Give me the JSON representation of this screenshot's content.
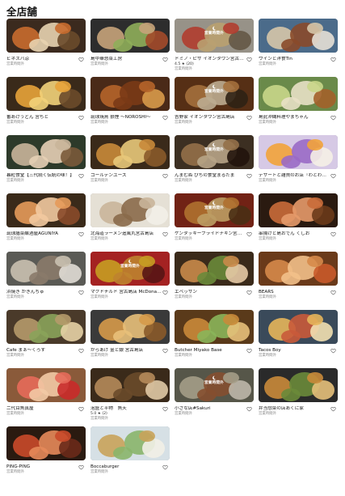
{
  "page": {
    "title": "全店舗"
  },
  "closed_overlay_text": "営業時間外",
  "icons": {
    "favorite": "heart-outline-icon",
    "closed": "moon-icon",
    "rating": "star-icon"
  },
  "stores": [
    {
      "name": "ビネスバ涼",
      "status": "営業時間外",
      "palette": [
        "#3b2a1e",
        "#c96b2e",
        "#e8d3b0",
        "#6a4a2a"
      ]
    },
    {
      "name": "島中華惣菜工房",
      "status": "営業時間外",
      "palette": [
        "#2d2d2d",
        "#c7a37a",
        "#8fae5a",
        "#a34a2a"
      ]
    },
    {
      "name": "ドミノ・ピザ イオンタウン宮古島店 Do…",
      "status": "営業時間外",
      "rating": "4.5 ★ (20)",
      "closed_overlay": true,
      "palette": [
        "#b9b3a6",
        "#d84a3a",
        "#e2c48a",
        "#7a6a55"
      ]
    },
    {
      "name": "ワインと洋食Tin",
      "status": "営業時間外",
      "palette": [
        "#4b6b8a",
        "#d6c7a8",
        "#8a4a2a",
        "#e5e0d5"
      ]
    },
    {
      "name": "番あげうどん 宮ちと",
      "status": "営業時間外",
      "palette": [
        "#3a2a1a",
        "#e8a33a",
        "#f2d27a",
        "#6b4a2a"
      ]
    },
    {
      "name": "琉球焼鳥 狼煙 〜NOROSHI〜",
      "status": "営業時間外",
      "palette": [
        "#4a2a18",
        "#b5642a",
        "#7a3a16",
        "#d89a4a"
      ]
    },
    {
      "name": "吉野家 イオンタウン宮古島店",
      "status": "営業時間外",
      "closed_overlay": true,
      "palette": [
        "#6a3a1a",
        "#c98a4a",
        "#e5d2b0",
        "#3a2a1a"
      ]
    },
    {
      "name": "島此沖縄料理やまちゃん",
      "status": "営業時間外",
      "palette": [
        "#6a8a4a",
        "#c9d68a",
        "#e8e0c5",
        "#a3602a"
      ]
    },
    {
      "name": "暮粒食堂【三代続く伝統の味！】",
      "status": "営業時間外",
      "palette": [
        "#2d3a2a",
        "#c9b59a",
        "#e5cfb5",
        "#7a5a3a"
      ]
    },
    {
      "name": "ゴールデンユース",
      "status": "営業時間外",
      "palette": [
        "#3a2a1a",
        "#c98a3a",
        "#e8c87a",
        "#8a5a2a"
      ]
    },
    {
      "name": "んまむぬ ぴちの食堂まるたま",
      "status": "営業時間外",
      "closed_overlay": true,
      "palette": [
        "#4a3a2a",
        "#b58a5a",
        "#e0c9a5",
        "#2a1a10"
      ]
    },
    {
      "name": "デザートと雑貨のお店『わとわと』",
      "status": "営業時間外",
      "palette": [
        "#d6c9e5",
        "#f2a33a",
        "#9a6ac5",
        "#f5efe5"
      ]
    },
    {
      "name": "琉球膳菜醸酒屋AGUNIYA",
      "status": "営業時間外",
      "palette": [
        "#3a2a1a",
        "#e59a5a",
        "#f2c9a0",
        "#8a4a2a"
      ]
    },
    {
      "name": "北海道ラーメン追風丸宮古島店",
      "status": "営業時間外",
      "palette": [
        "#e5e0d5",
        "#c9b59a",
        "#8a6a4a",
        "#f2efe8"
      ]
    },
    {
      "name": "ケンタッキーフライドチキン宮古島店 KFC",
      "status": "営業時間外",
      "closed_overlay": true,
      "palette": [
        "#8a2a1a",
        "#d68a3a",
        "#e5c07a",
        "#5a3a1a"
      ]
    },
    {
      "name": "串揚げと島おでん くしお",
      "status": "営業時間外",
      "palette": [
        "#2a1a10",
        "#c96b3a",
        "#e59a6a",
        "#6a3a1a"
      ]
    },
    {
      "name": "浜焼き かきんちゅ",
      "status": "営業時間外",
      "palette": [
        "#5a5a55",
        "#c9c0b0",
        "#8a7a6a",
        "#e0dcd5"
      ]
    },
    {
      "name": "マクドナルド 宮古島店 McDonald's…",
      "status": "営業時間外",
      "closed_overlay": true,
      "palette": [
        "#c92a2a",
        "#f2c02a",
        "#e8a03a",
        "#6a1a1a"
      ]
    },
    {
      "name": "エベッサン",
      "status": "営業時間外",
      "palette": [
        "#3a2a1a",
        "#c98a4a",
        "#6a8a3a",
        "#e5c9a5"
      ]
    },
    {
      "name": "BEARS",
      "status": "営業時間外",
      "palette": [
        "#6a3a1a",
        "#d68a4a",
        "#f2c08a",
        "#c95a2a"
      ]
    },
    {
      "name": "Cafe まぁ〜くろす",
      "status": "営業時間外",
      "palette": [
        "#4a3a2a",
        "#b59a6a",
        "#8aa35a",
        "#e5d2a5"
      ]
    },
    {
      "name": "からあげ 金と銀 宮古島店",
      "status": "営業時間外",
      "palette": [
        "#3a3a3a",
        "#d69a4a",
        "#e8c07a",
        "#8a5a2a"
      ]
    },
    {
      "name": "Butcher Miyako Base",
      "status": "営業時間外",
      "palette": [
        "#5a3a1a",
        "#c98a3a",
        "#8ab55a",
        "#e5c07a"
      ]
    },
    {
      "name": "Tacos Boy",
      "status": "営業時間外",
      "palette": [
        "#3a4a5a",
        "#e5b55a",
        "#c95a3a",
        "#f2e0b0"
      ]
    },
    {
      "name": "二代目魚真屋",
      "status": "営業時間外",
      "palette": [
        "#8a5a3a",
        "#e56a5a",
        "#f2c9a5",
        "#c92a2a"
      ]
    },
    {
      "name": "泡盛と平物　魚天",
      "status": "営業時間外",
      "rating": "5.0 ★ (2)",
      "palette": [
        "#3a2a1a",
        "#b58a5a",
        "#6a4a2a",
        "#e0c9a5"
      ]
    },
    {
      "name": "小さな店#Sakuri",
      "status": "営業時間外",
      "closed_overlay": true,
      "palette": [
        "#6a6a5a",
        "#c9c0a5",
        "#a3603a",
        "#e8e0cf"
      ]
    },
    {
      "name": "弁当惣菜の店あくに家",
      "status": "営業時間外",
      "palette": [
        "#2a2a2a",
        "#c98a3a",
        "#6a8a3a",
        "#e5c07a"
      ]
    },
    {
      "name": "PING-PING",
      "status": "営業時間外",
      "palette": [
        "#2a1a10",
        "#c94a2a",
        "#e58a5a",
        "#6a2a1a"
      ]
    },
    {
      "name": "Boccaburger",
      "status": "営業時間外",
      "palette": [
        "#d6e0e5",
        "#c9a35a",
        "#8ab56a",
        "#f2efe5"
      ]
    }
  ]
}
